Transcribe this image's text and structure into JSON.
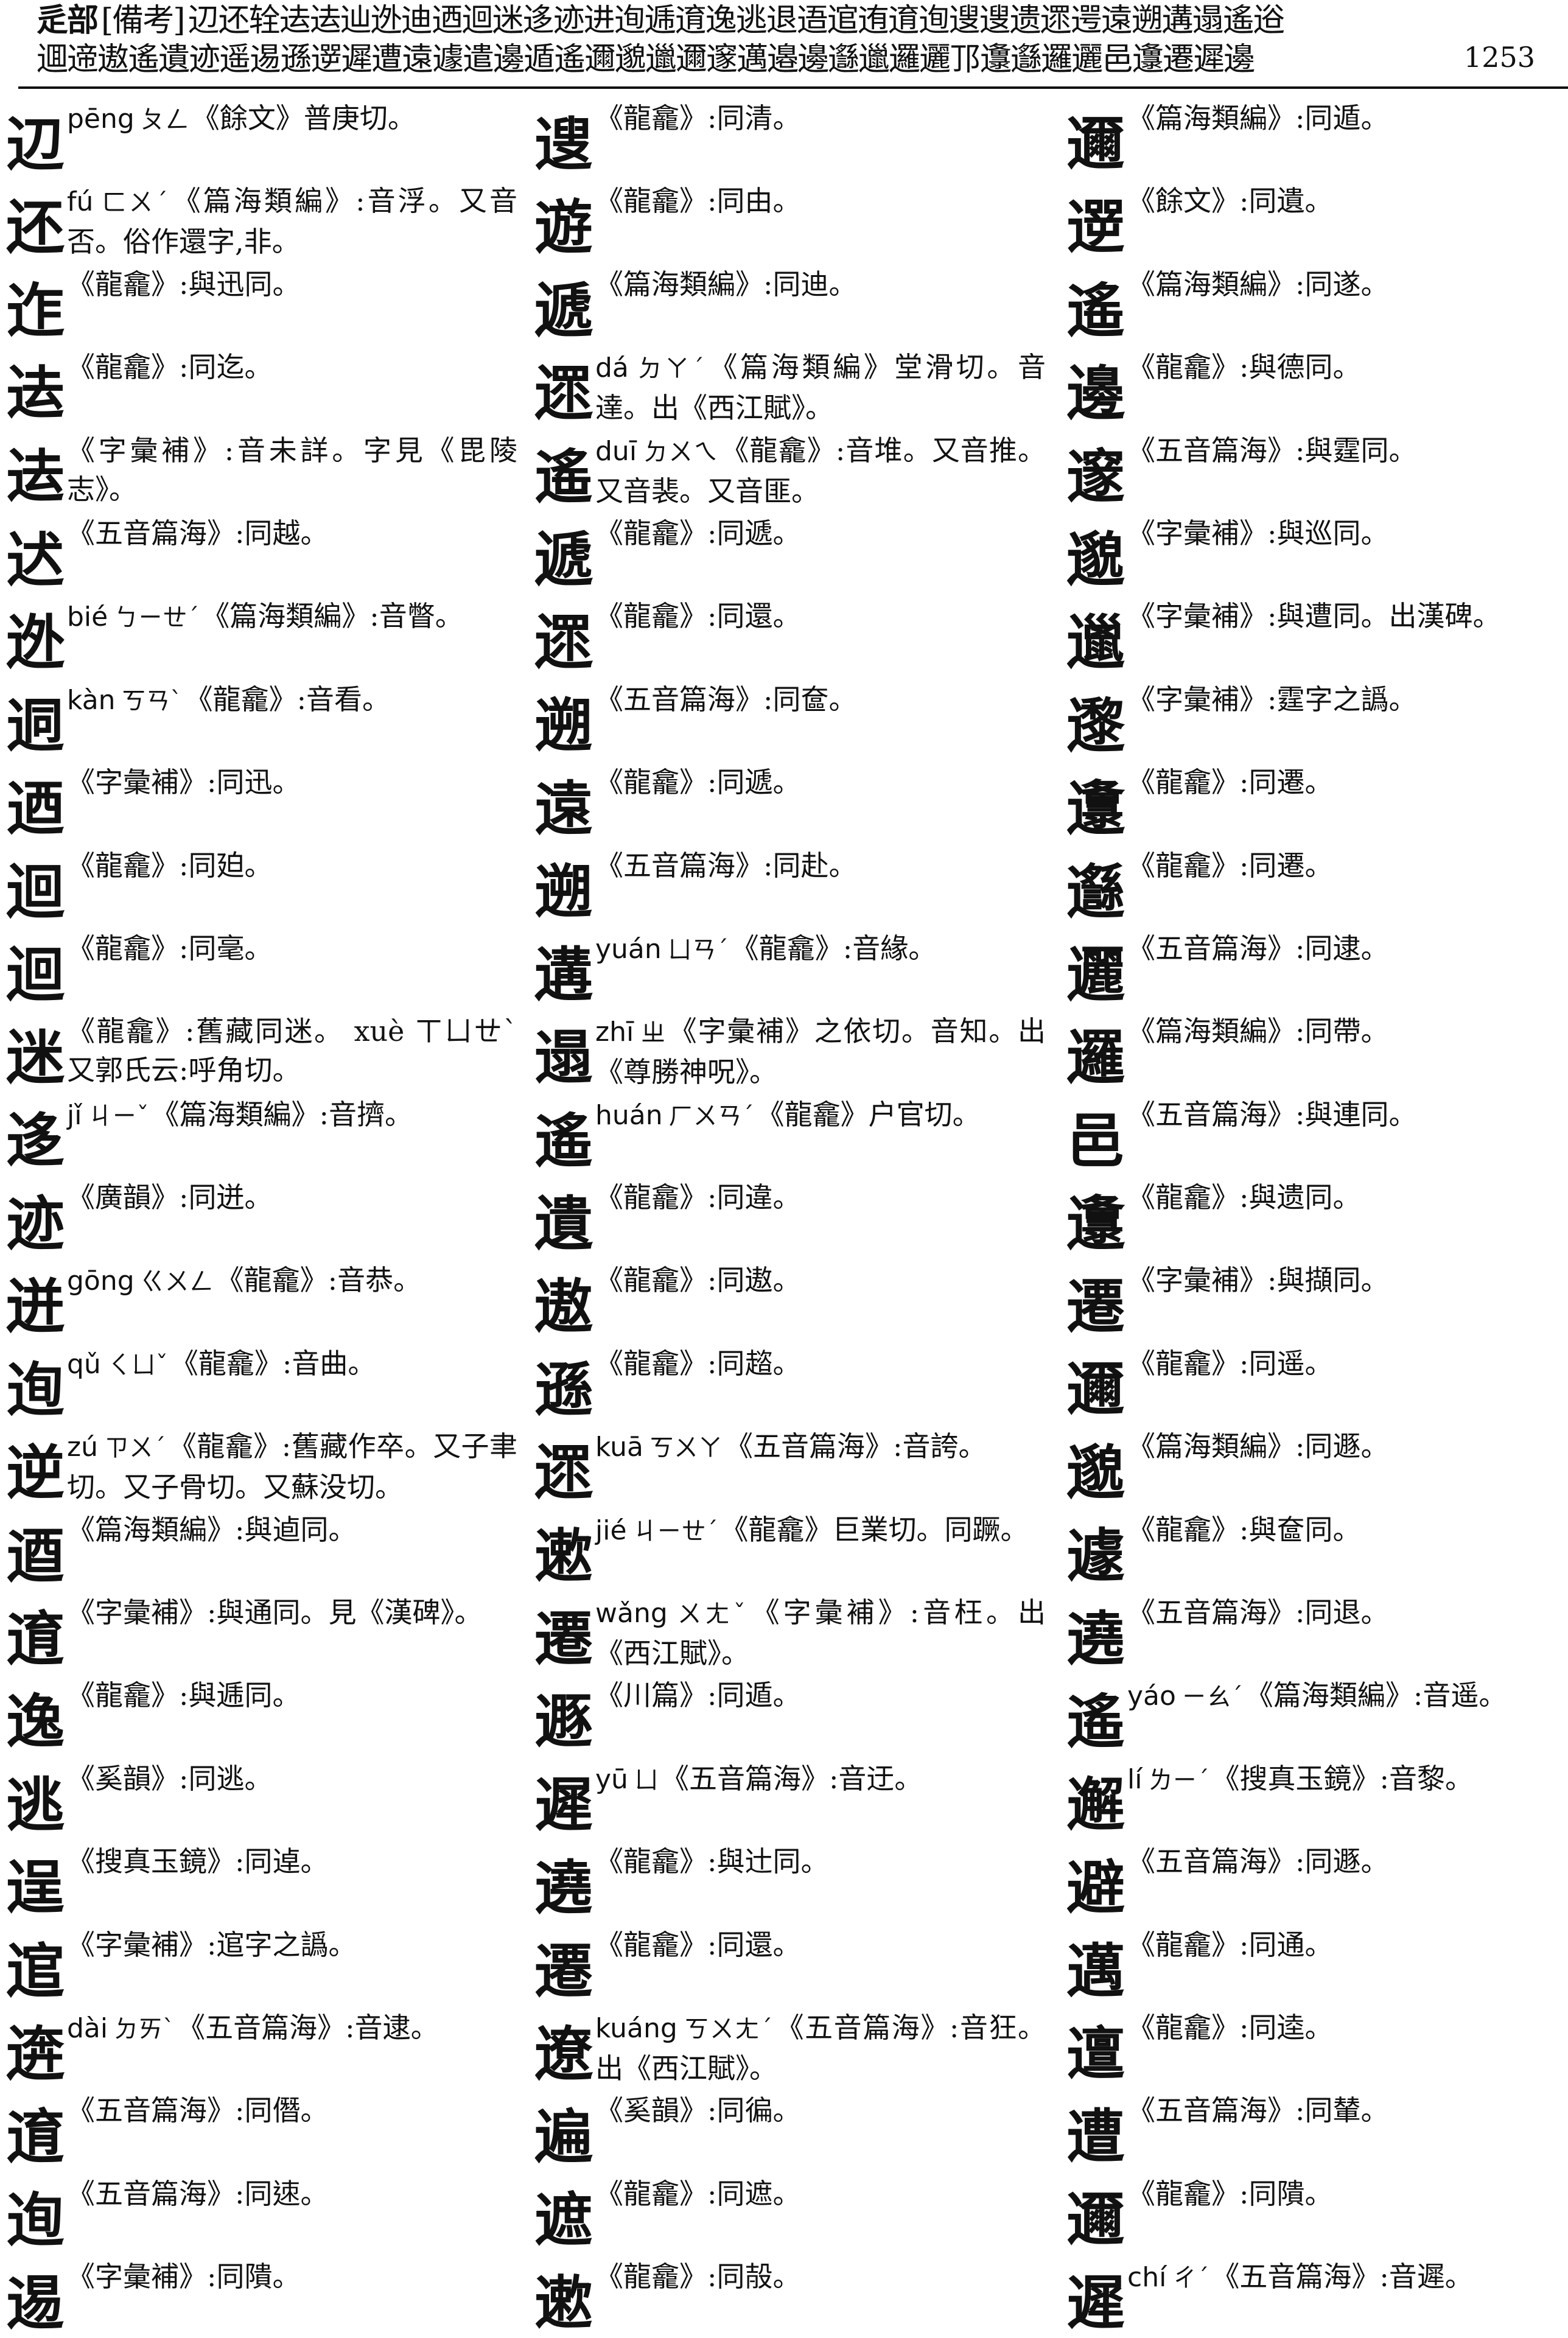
{
  "header": {
    "section": "辵部",
    "note": "[備考]",
    "line1": "辺还辁迲迲辿迯迪迺迴迷迻迹进迿逓逳逸逃退逜逭迶逳迿遚遚遗遝遌遠遡遘遢遙逧",
    "line2": "逥遆遨遙遺迹遥逷遜遻遲遭遠遽遣邊遁遙邇邈邋邇邃邁邉邊邎邋邏邐邒邍邎邏邐邑邍遷遲邊",
    "page_number": "1253"
  },
  "columns": [
    {
      "entries": [
        {
          "hw": "辺",
          "pinyin": "pēng",
          "zhuyin": "ㄆㄥ",
          "text": "《餘文》普庚切。"
        },
        {
          "hw": "还",
          "pinyin": "fú",
          "zhuyin": "ㄈㄨˊ",
          "text": "《篇海類編》:音浮。又音否。俗作還字,非。"
        },
        {
          "hw": "迮",
          "pinyin": "",
          "zhuyin": "",
          "text": "《龍龕》:與迅同。"
        },
        {
          "hw": "迲",
          "pinyin": "",
          "zhuyin": "",
          "text": "《龍龕》:同迄。"
        },
        {
          "hw": "迲",
          "pinyin": "",
          "zhuyin": "",
          "text": "《字彙補》:音未詳。字見《毘陵志》。"
        },
        {
          "hw": "迖",
          "pinyin": "",
          "zhuyin": "",
          "text": "《五音篇海》:同越。"
        },
        {
          "hw": "迯",
          "pinyin": "bié",
          "zhuyin": "ㄅㄧㄝˊ",
          "text": "《篇海類編》:音瞥。"
        },
        {
          "hw": "迵",
          "pinyin": "kàn",
          "zhuyin": "ㄎㄢˋ",
          "text": "《龍龕》:音看。"
        },
        {
          "hw": "迺",
          "pinyin": "",
          "zhuyin": "",
          "text": "《字彙補》:同迅。"
        },
        {
          "hw": "迴",
          "pinyin": "",
          "zhuyin": "",
          "text": "《龍龕》:同廹。"
        },
        {
          "hw": "迴",
          "pinyin": "",
          "zhuyin": "",
          "text": "《龍龕》:同毫。"
        },
        {
          "hw": "迷",
          "pinyin": "",
          "zhuyin": "",
          "text": "《龍龕》:舊藏同迷。 xuè ㄒㄩㄝˋ 又郭氏云:呼角切。"
        },
        {
          "hw": "迻",
          "pinyin": "jǐ",
          "zhuyin": "ㄐㄧˇ",
          "text": "《篇海類編》:音擠。"
        },
        {
          "hw": "迹",
          "pinyin": "",
          "zhuyin": "",
          "text": "《廣韻》:同迸。"
        },
        {
          "hw": "迸",
          "pinyin": "gōng",
          "zhuyin": "ㄍㄨㄥ",
          "text": "《龍龕》:音恭。"
        },
        {
          "hw": "迿",
          "pinyin": "qǔ",
          "zhuyin": "ㄑㄩˇ",
          "text": "《龍龕》:音曲。"
        },
        {
          "hw": "逆",
          "pinyin": "zú",
          "zhuyin": "ㄗㄨˊ",
          "text": "《龍龕》:舊藏作卒。又子聿切。又子骨切。又蘇没切。"
        },
        {
          "hw": "逎",
          "pinyin": "",
          "zhuyin": "",
          "text": "《篇海類編》:與逌同。"
        },
        {
          "hw": "逳",
          "pinyin": "",
          "zhuyin": "",
          "text": "《字彙補》:與通同。見《漢碑》。"
        },
        {
          "hw": "逸",
          "pinyin": "",
          "zhuyin": "",
          "text": "《龍龕》:與逓同。"
        },
        {
          "hw": "逃",
          "pinyin": "",
          "zhuyin": "",
          "text": "《奚韻》:同逃。"
        },
        {
          "hw": "逞",
          "pinyin": "",
          "zhuyin": "",
          "text": "《搜真玉鏡》:同逴。"
        },
        {
          "hw": "逭",
          "pinyin": "",
          "zhuyin": "",
          "text": "《字彙補》:逭字之譌。"
        },
        {
          "hw": "逩",
          "pinyin": "dài",
          "zhuyin": "ㄉㄞˋ",
          "text": "《五音篇海》:音逮。"
        },
        {
          "hw": "逳",
          "pinyin": "",
          "zhuyin": "",
          "text": "《五音篇海》:同僭。"
        },
        {
          "hw": "迿",
          "pinyin": "",
          "zhuyin": "",
          "text": "《五音篇海》:同𨒪。"
        },
        {
          "hw": "逷",
          "pinyin": "",
          "zhuyin": "",
          "text": "《字彙補》:同隤。"
        }
      ]
    },
    {
      "entries": [
        {
          "hw": "遚",
          "pinyin": "",
          "zhuyin": "",
          "text": "《龍龕》:同清。"
        },
        {
          "hw": "遊",
          "pinyin": "",
          "zhuyin": "",
          "text": "《龍龕》:同由。"
        },
        {
          "hw": "遞",
          "pinyin": "",
          "zhuyin": "",
          "text": "《篇海類編》:同迪。"
        },
        {
          "hw": "遝",
          "pinyin": "dá",
          "zhuyin": "ㄉㄚˊ",
          "text": "《篇海類編》堂滑切。音達。出《西江賦》。"
        },
        {
          "hw": "遙",
          "pinyin": "duī",
          "zhuyin": "ㄉㄨㄟ",
          "text": "《龍龕》:音堆。又音推。又音裴。又音匪。"
        },
        {
          "hw": "遞",
          "pinyin": "",
          "zhuyin": "",
          "text": "《龍龕》:同遞。"
        },
        {
          "hw": "遝",
          "pinyin": "",
          "zhuyin": "",
          "text": "《龍龕》:同還。"
        },
        {
          "hw": "遡",
          "pinyin": "",
          "zhuyin": "",
          "text": "《五音篇海》:同奩。"
        },
        {
          "hw": "遠",
          "pinyin": "",
          "zhuyin": "",
          "text": "《龍龕》:同遞。"
        },
        {
          "hw": "遡",
          "pinyin": "",
          "zhuyin": "",
          "text": "《五音篇海》:同赴。"
        },
        {
          "hw": "遘",
          "pinyin": "yuán",
          "zhuyin": "ㄩㄢˊ",
          "text": "《龍龕》:音緣。"
        },
        {
          "hw": "遢",
          "pinyin": "zhī",
          "zhuyin": "ㄓ",
          "text": "《字彙補》之依切。音知。出《尊勝神呪》。"
        },
        {
          "hw": "遙",
          "pinyin": "huán",
          "zhuyin": "ㄏㄨㄢˊ",
          "text": "《龍龕》户官切。"
        },
        {
          "hw": "遺",
          "pinyin": "",
          "zhuyin": "",
          "text": "《龍龕》:同違。"
        },
        {
          "hw": "遨",
          "pinyin": "",
          "zhuyin": "",
          "text": "《龍龕》:同遨。"
        },
        {
          "hw": "遜",
          "pinyin": "",
          "zhuyin": "",
          "text": "《龍龕》:同趦。"
        },
        {
          "hw": "遝",
          "pinyin": "kuā",
          "zhuyin": "ㄎㄨㄚ",
          "text": "《五音篇海》:音誇。"
        },
        {
          "hw": "遬",
          "pinyin": "jié",
          "zhuyin": "ㄐㄧㄝˊ",
          "text": "《龍龕》巨業切。同蹶。"
        },
        {
          "hw": "遷",
          "pinyin": "wǎng",
          "zhuyin": "ㄨㄤˇ",
          "text": "《字彙補》:音枉。出《西江賦》。"
        },
        {
          "hw": "遯",
          "pinyin": "",
          "zhuyin": "",
          "text": "《川篇》:同遁。"
        },
        {
          "hw": "遲",
          "pinyin": "yū",
          "zhuyin": "ㄩ",
          "text": "《五音篇海》:音迂。"
        },
        {
          "hw": "遶",
          "pinyin": "",
          "zhuyin": "",
          "text": "《龍龕》:與辻同。"
        },
        {
          "hw": "遷",
          "pinyin": "",
          "zhuyin": "",
          "text": "《龍龕》:同還。"
        },
        {
          "hw": "遼",
          "pinyin": "kuáng",
          "zhuyin": "ㄎㄨㄤˊ",
          "text": "《五音篇海》:音狂。出《西江賦》。"
        },
        {
          "hw": "遍",
          "pinyin": "",
          "zhuyin": "",
          "text": "《奚韻》:同徧。"
        },
        {
          "hw": "遮",
          "pinyin": "",
          "zhuyin": "",
          "text": "《龍龕》:同遮。"
        },
        {
          "hw": "遬",
          "pinyin": "",
          "zhuyin": "",
          "text": "《龍龕》:同㱿。"
        }
      ]
    },
    {
      "entries": [
        {
          "hw": "邇",
          "pinyin": "",
          "zhuyin": "",
          "text": "《篇海類編》:同遁。"
        },
        {
          "hw": "遻",
          "pinyin": "",
          "zhuyin": "",
          "text": "《餘文》:同遺。"
        },
        {
          "hw": "遙",
          "pinyin": "",
          "zhuyin": "",
          "text": "《篇海類編》:同遂。"
        },
        {
          "hw": "邊",
          "pinyin": "",
          "zhuyin": "",
          "text": "《龍龕》:與德同。"
        },
        {
          "hw": "邃",
          "pinyin": "",
          "zhuyin": "",
          "text": "《五音篇海》:與霆同。"
        },
        {
          "hw": "邈",
          "pinyin": "",
          "zhuyin": "",
          "text": "《字彙補》:與巡同。"
        },
        {
          "hw": "邋",
          "pinyin": "",
          "zhuyin": "",
          "text": "《字彙補》:與遭同。出漢碑。"
        },
        {
          "hw": "邌",
          "pinyin": "",
          "zhuyin": "",
          "text": "《字彙補》:霆字之譌。"
        },
        {
          "hw": "邍",
          "pinyin": "",
          "zhuyin": "",
          "text": "《龍龕》:同遷。"
        },
        {
          "hw": "邎",
          "pinyin": "",
          "zhuyin": "",
          "text": "《龍龕》:同遷。"
        },
        {
          "hw": "邐",
          "pinyin": "",
          "zhuyin": "",
          "text": "《五音篇海》:同逮。"
        },
        {
          "hw": "邏",
          "pinyin": "",
          "zhuyin": "",
          "text": "《篇海類編》:同帶。"
        },
        {
          "hw": "邑",
          "pinyin": "",
          "zhuyin": "",
          "text": "《五音篇海》:與連同。"
        },
        {
          "hw": "邍",
          "pinyin": "",
          "zhuyin": "",
          "text": "《龍龕》:與遗同。"
        },
        {
          "hw": "遷",
          "pinyin": "",
          "zhuyin": "",
          "text": "《字彙補》:與擷同。"
        },
        {
          "hw": "邇",
          "pinyin": "",
          "zhuyin": "",
          "text": "《龍龕》:同遥。"
        },
        {
          "hw": "邈",
          "pinyin": "",
          "zhuyin": "",
          "text": "《篇海類編》:同遯。"
        },
        {
          "hw": "遽",
          "pinyin": "",
          "zhuyin": "",
          "text": "《龍龕》:與奩同。"
        },
        {
          "hw": "遶",
          "pinyin": "",
          "zhuyin": "",
          "text": "《五音篇海》:同退。"
        },
        {
          "hw": "遙",
          "pinyin": "yáo",
          "zhuyin": "ㄧㄠˊ",
          "text": "《篇海類編》:音遥。"
        },
        {
          "hw": "邂",
          "pinyin": "lí",
          "zhuyin": "ㄌㄧˊ",
          "text": "《搜真玉鏡》:音黎。"
        },
        {
          "hw": "避",
          "pinyin": "",
          "zhuyin": "",
          "text": "《五音篇海》:同遯。"
        },
        {
          "hw": "邁",
          "pinyin": "",
          "zhuyin": "",
          "text": "《龍龕》:同通。"
        },
        {
          "hw": "邅",
          "pinyin": "",
          "zhuyin": "",
          "text": "《龍龕》:同逵。"
        },
        {
          "hw": "遭",
          "pinyin": "",
          "zhuyin": "",
          "text": "《五音篇海》:同輦。"
        },
        {
          "hw": "邇",
          "pinyin": "",
          "zhuyin": "",
          "text": "《龍龕》:同隤。"
        },
        {
          "hw": "遲",
          "pinyin": "chí",
          "zhuyin": "ㄔˊ",
          "text": "《五音篇海》:音遲。"
        }
      ]
    }
  ]
}
